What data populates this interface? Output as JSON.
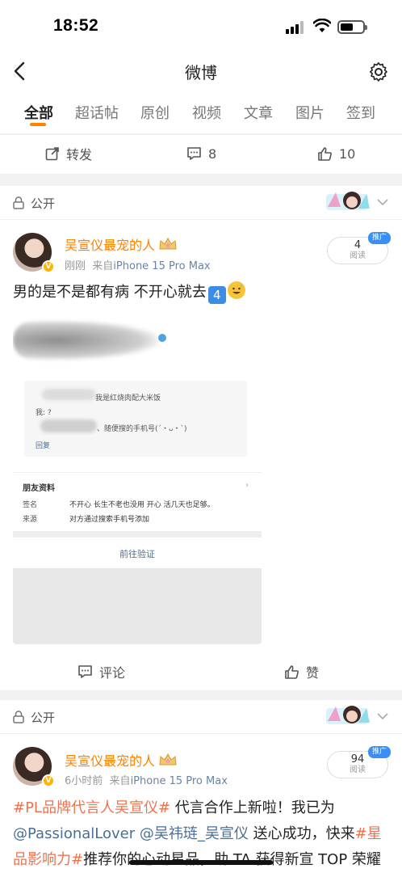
{
  "status_bar": {
    "time": "18:52"
  },
  "nav": {
    "title": "微博"
  },
  "tabs": [
    "全部",
    "超话帖",
    "原创",
    "视频",
    "文章",
    "图片",
    "签到"
  ],
  "prev_post_actions": {
    "repost": "转发",
    "comments": "8",
    "likes": "10"
  },
  "posts": [
    {
      "visibility": "公开",
      "author": "吴宣仪最宠的人",
      "time": "刚刚",
      "source_prefix": "来自",
      "source": "iPhone 15 Pro Max",
      "read_count": "4",
      "read_label": "阅读",
      "promo": "推广",
      "text": "男的是不是都有病 不开心就去",
      "emoji_number": "4",
      "comment_label": "评论",
      "like_label": "赞",
      "image": {
        "msg_line1": "我是红烧肉配大米饭",
        "msg_line2": "我: ?",
        "msg_line3": "、随便搜的手机号(´・ᴗ・`)",
        "reply": "回复",
        "friend_title": "朋友资料",
        "sign_label": "签名",
        "sign_value": "不开心 长生不老也没用 开心 活几天也足够。",
        "source_label": "来源",
        "source_value": "对方通过搜索手机号添加",
        "verify": "前往验证"
      }
    },
    {
      "visibility": "公开",
      "author": "吴宣仪最宠的人",
      "time": "6小时前",
      "source_prefix": "来自",
      "source": "iPhone 15 Pro Max",
      "read_count": "94",
      "read_label": "阅读",
      "promo": "推广",
      "hashtag1": "#PL品牌代言人吴宣仪#",
      "text1": " 代言合作上新啦！我已为",
      "mention1": "@PassionalLover",
      "mention2": "@吴祎琏_吴宣仪",
      "text2": " 送心成功，快来",
      "hashtag2": "#星品影响力#",
      "text3": "推荐你的心动星品，助 TA 获得新宣 TOP 荣耀吧！"
    }
  ],
  "colors": {
    "accent": "#ff8200",
    "link": "#4a6e96",
    "hashtag": "#eb7350",
    "promo": "#3b8ef3"
  }
}
